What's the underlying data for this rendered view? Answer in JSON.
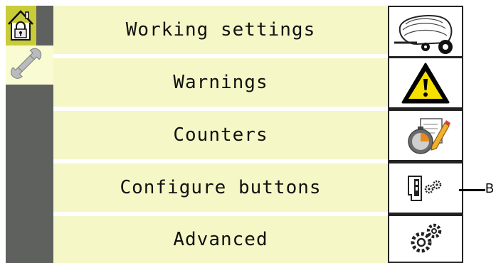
{
  "menu": {
    "items": [
      {
        "label": "Working settings",
        "icon": "baler-icon"
      },
      {
        "label": "Warnings",
        "icon": "warning-icon"
      },
      {
        "label": "Counters",
        "icon": "stopwatch-icon"
      },
      {
        "label": "Configure buttons",
        "icon": "configure-buttons-icon"
      },
      {
        "label": "Advanced",
        "icon": "gears-icon"
      }
    ]
  },
  "nav": {
    "home_icon": "locked-home-icon",
    "tools_icon": "wrench-icon"
  },
  "callout": {
    "label": "B"
  },
  "colors": {
    "menu_row_bg": "#f5f7c6",
    "active_tab": "#c8cc36",
    "sidebar": "#5e615e",
    "warning_yellow": "#f5e000"
  }
}
